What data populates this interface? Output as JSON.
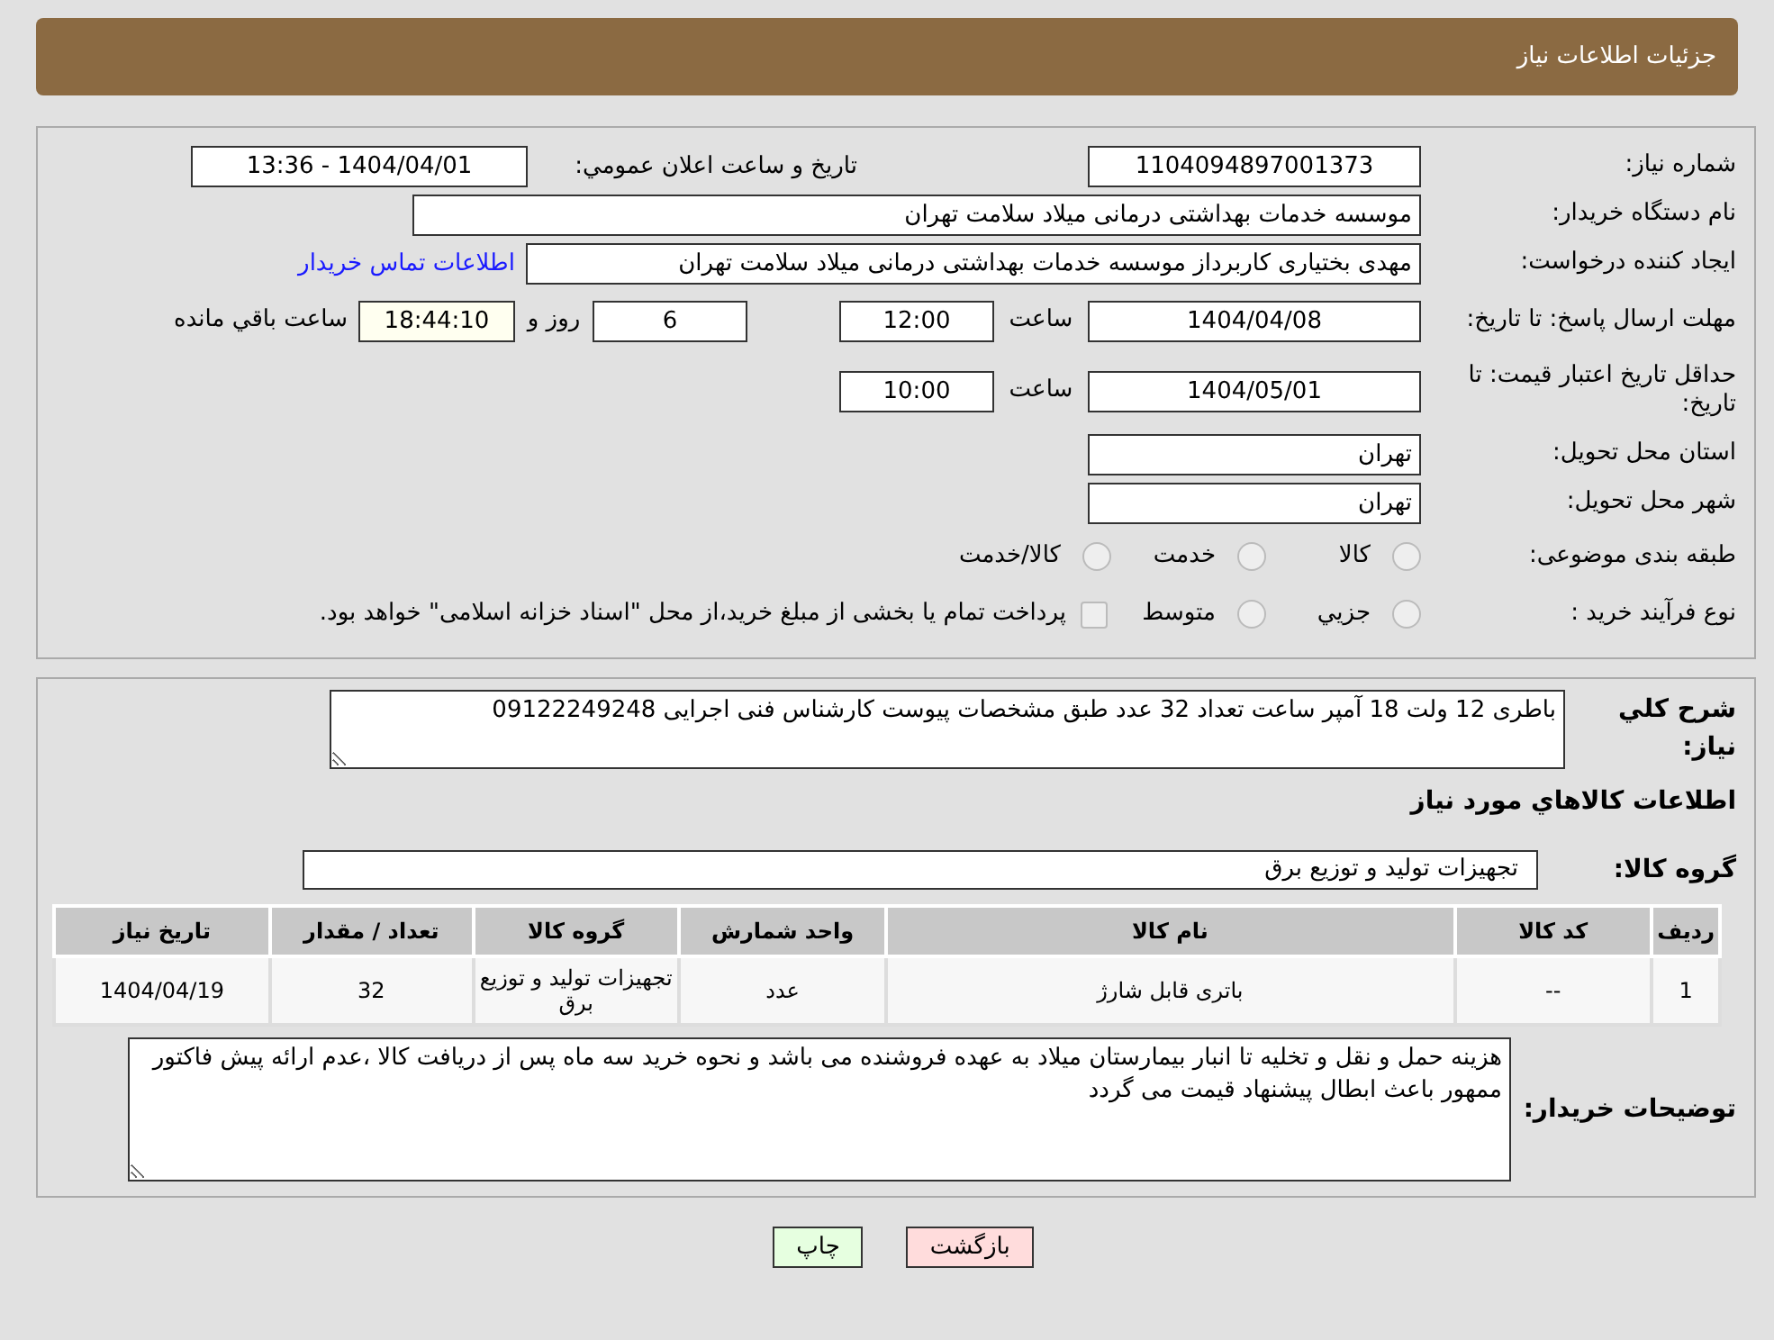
{
  "header": {
    "title": "جزئیات اطلاعات نیاز"
  },
  "details": {
    "need_number": {
      "label": "شماره نیاز:",
      "value": "1104094897001373"
    },
    "announce": {
      "label": "تاریخ و ساعت اعلان عمومي:",
      "value": "1404/04/01 - 13:36"
    },
    "buyer": {
      "label": "نام دستگاه خریدار:",
      "value": "موسسه خدمات بهداشتی درمانی میلاد سلامت تهران"
    },
    "creator": {
      "label": "ایجاد کننده درخواست:",
      "value": "مهدی بختیاری کاربرداز موسسه خدمات بهداشتی درمانی میلاد سلامت تهران",
      "link": "اطلاعات تماس خریدار"
    },
    "deadline": {
      "label": "مهلت ارسال پاسخ: تا تاریخ:",
      "date": "1404/04/08",
      "time_label": "ساعت",
      "time": "12:00",
      "days": "6",
      "days_label": "روز و",
      "remaining": "18:44:10",
      "remaining_label": "ساعت باقي مانده"
    },
    "validity": {
      "label": "حداقل تاریخ اعتبار قیمت: تا تاریخ:",
      "date": "1404/05/01",
      "time_label": "ساعت",
      "time": "10:00"
    },
    "province": {
      "label": "استان محل تحویل:",
      "value": "تهران"
    },
    "city": {
      "label": "شهر محل تحویل:",
      "value": "تهران"
    },
    "category": {
      "label": "طبقه بندی موضوعی:",
      "options": [
        {
          "label": "کالا",
          "selected": false
        },
        {
          "label": "خدمت",
          "selected": false
        },
        {
          "label": "کالا/خدمت",
          "selected": false
        }
      ]
    },
    "process": {
      "label": "نوع فرآیند خرید :",
      "options": [
        {
          "label": "جزيي",
          "selected": false
        },
        {
          "label": "متوسط",
          "selected": false
        }
      ],
      "payment": {
        "checked": false,
        "text": "پرداخت تمام یا بخشی از مبلغ خرید،از محل \"اسناد خزانه اسلامی\" خواهد بود."
      }
    }
  },
  "description": {
    "label": "شرح کلي نیاز:",
    "value": "باطری 12 ولت 18 آمپر ساعت تعداد 32 عدد طبق مشخصات پیوست کارشناس فنی اجرایی 09122249248"
  },
  "goods_title": "اطلاعات کالاهاي مورد نیاز",
  "goods_group": {
    "label": "گروه کالا:",
    "value": "تجهیزات تولید و توزیع برق"
  },
  "table": {
    "columns": [
      "ردیف",
      "کد کالا",
      "نام کالا",
      "واحد شمارش",
      "گروه کالا",
      "تعداد / مقدار",
      "تاریخ نیاز"
    ],
    "rows": [
      [
        "1",
        "--",
        "باتری قابل شارژ",
        "عدد",
        "تجهیزات تولید و توزیع برق",
        "32",
        "1404/04/19"
      ]
    ]
  },
  "buyer_notes": {
    "label": "توضیحات خریدار:",
    "value": "هزینه حمل و نقل و تخلیه تا انبار بیمارستان میلاد به عهده فروشنده می باشد و نحوه خرید سه ماه پس از دریافت کالا ،عدم ارائه پیش فاکتور ممهور باعث ابطال پیشنهاد قیمت می گردد"
  },
  "buttons": [
    {
      "label": "بازگشت",
      "kind": "back"
    },
    {
      "label": "چاپ",
      "kind": "print"
    }
  ]
}
